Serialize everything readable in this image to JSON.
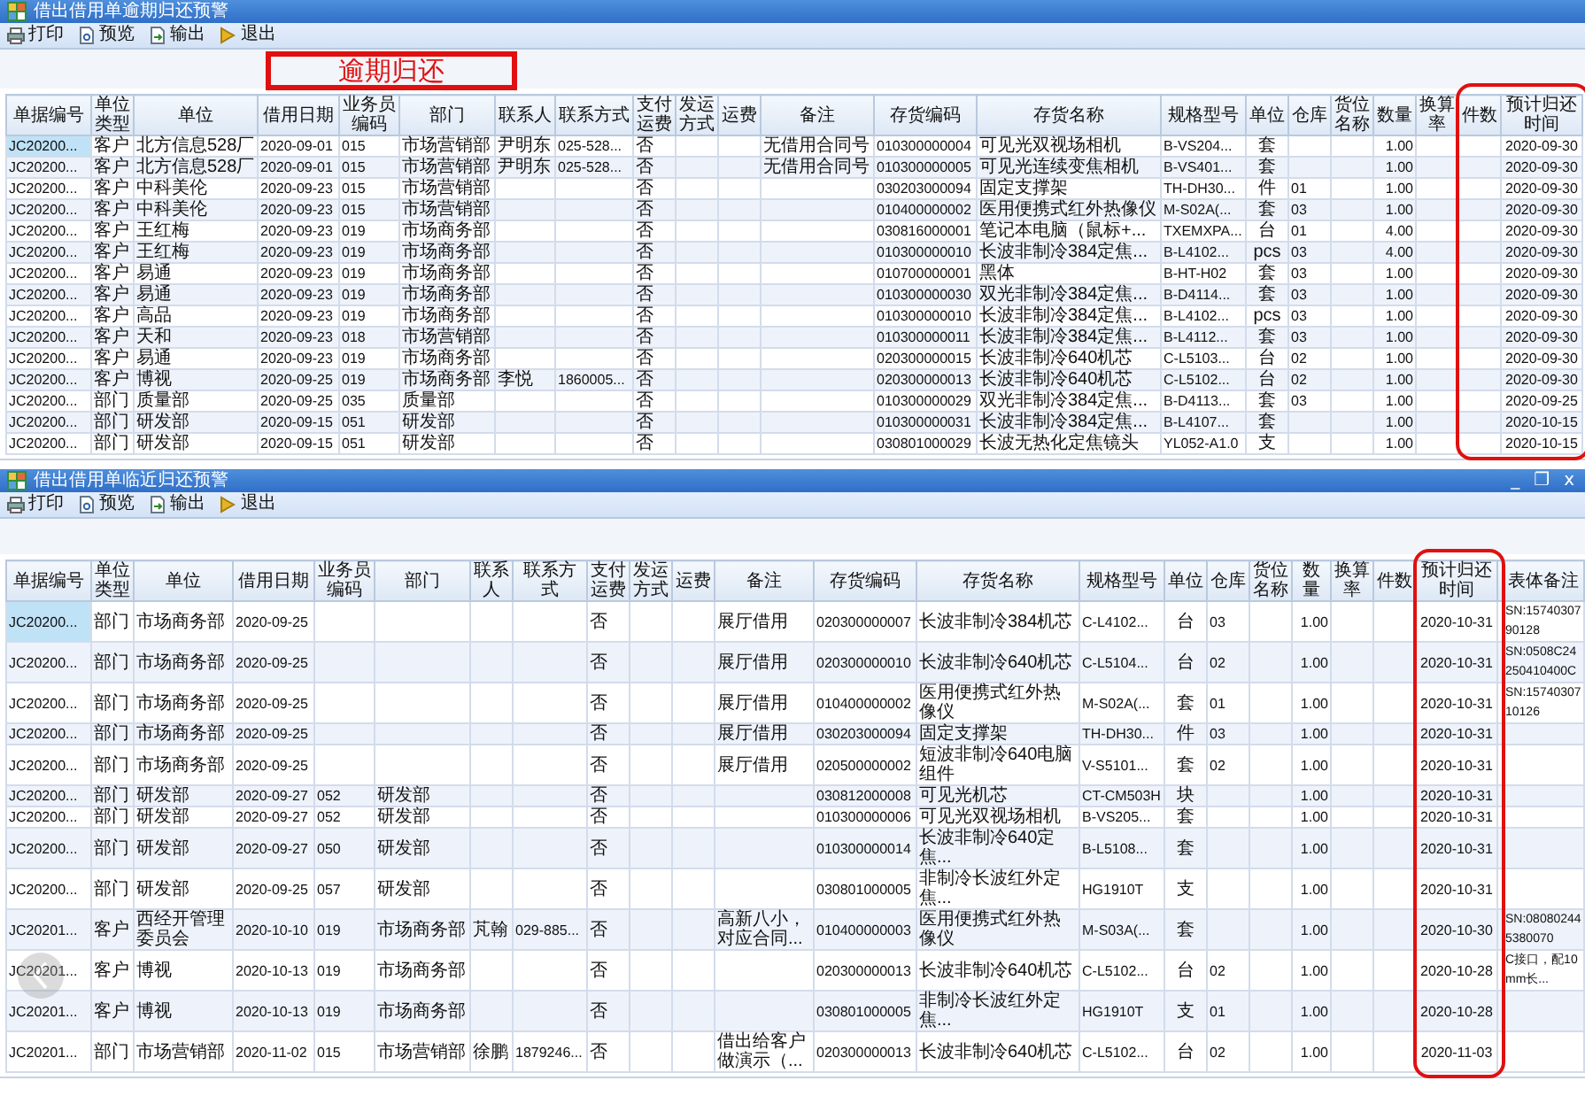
{
  "windows": [
    {
      "title": "借出借用单逾期归还预警",
      "toolbar": [
        {
          "label": "打印",
          "kind": "print"
        },
        {
          "label": "预览",
          "kind": "preview"
        },
        {
          "label": "输出",
          "kind": "export"
        },
        {
          "label": "退出",
          "kind": "exit"
        }
      ],
      "annotation": "逾期归还",
      "columns": [
        {
          "label": "单据编号",
          "highlighted": false
        },
        {
          "label": "单位类型",
          "highlighted": false
        },
        {
          "label": "单位",
          "highlighted": false
        },
        {
          "label": "借用日期",
          "highlighted": false
        },
        {
          "label": "业务员编码",
          "highlighted": false
        },
        {
          "label": "部门",
          "highlighted": false
        },
        {
          "label": "联系人",
          "highlighted": false
        },
        {
          "label": "联系方式",
          "highlighted": false
        },
        {
          "label": "支付运费",
          "highlighted": false
        },
        {
          "label": "发运方式",
          "highlighted": false
        },
        {
          "label": "运费",
          "highlighted": false
        },
        {
          "label": "备注",
          "highlighted": false
        },
        {
          "label": "存货编码",
          "highlighted": false
        },
        {
          "label": "存货名称",
          "highlighted": false
        },
        {
          "label": "规格型号",
          "highlighted": false
        },
        {
          "label": "单位",
          "highlighted": false
        },
        {
          "label": "仓库",
          "highlighted": false
        },
        {
          "label": "货位名称",
          "highlighted": false
        },
        {
          "label": "数量",
          "highlighted": false
        },
        {
          "label": "换算率",
          "highlighted": false
        },
        {
          "label": "件数",
          "highlighted": true
        },
        {
          "label": "预计归还时间",
          "highlighted": true
        }
      ],
      "rows": [
        {
          "selected": true,
          "cells": [
            "JC20200...",
            "客户",
            "北方信息528厂",
            "2020-09-01",
            "015",
            "市场营销部",
            "尹明东",
            "025-528...",
            "否",
            "",
            "",
            "无借用合同号",
            "010300000004",
            "可见光双视场相机",
            "B-VS204...",
            "套",
            "",
            "",
            "1.00",
            "",
            "",
            "2020-09-30"
          ]
        },
        {
          "selected": false,
          "cells": [
            "JC20200...",
            "客户",
            "北方信息528厂",
            "2020-09-01",
            "015",
            "市场营销部",
            "尹明东",
            "025-528...",
            "否",
            "",
            "",
            "无借用合同号",
            "010300000005",
            "可见光连续变焦相机",
            "B-VS401...",
            "套",
            "",
            "",
            "1.00",
            "",
            "",
            "2020-09-30"
          ]
        },
        {
          "selected": false,
          "cells": [
            "JC20200...",
            "客户",
            "中科美伦",
            "2020-09-23",
            "015",
            "市场营销部",
            "",
            "",
            "否",
            "",
            "",
            "",
            "030203000094",
            "固定支撑架",
            "TH-DH30...",
            "件",
            "01",
            "",
            "1.00",
            "",
            "",
            "2020-09-30"
          ]
        },
        {
          "selected": false,
          "cells": [
            "JC20200...",
            "客户",
            "中科美伦",
            "2020-09-23",
            "015",
            "市场营销部",
            "",
            "",
            "否",
            "",
            "",
            "",
            "010400000002",
            "医用便携式红外热像仪",
            "M-S02A(...",
            "套",
            "03",
            "",
            "1.00",
            "",
            "",
            "2020-09-30"
          ]
        },
        {
          "selected": false,
          "cells": [
            "JC20200...",
            "客户",
            "王红梅",
            "2020-09-23",
            "019",
            "市场商务部",
            "",
            "",
            "否",
            "",
            "",
            "",
            "030816000001",
            "笔记本电脑（鼠标+...",
            "TXEMXPA...",
            "台",
            "01",
            "",
            "4.00",
            "",
            "",
            "2020-09-30"
          ]
        },
        {
          "selected": false,
          "cells": [
            "JC20200...",
            "客户",
            "王红梅",
            "2020-09-23",
            "019",
            "市场商务部",
            "",
            "",
            "否",
            "",
            "",
            "",
            "010300000010",
            "长波非制冷384定焦...",
            "B-L4102...",
            "pcs",
            "03",
            "",
            "4.00",
            "",
            "",
            "2020-09-30"
          ]
        },
        {
          "selected": false,
          "cells": [
            "JC20200...",
            "客户",
            "易通",
            "2020-09-23",
            "019",
            "市场商务部",
            "",
            "",
            "否",
            "",
            "",
            "",
            "010700000001",
            "黑体",
            "B-HT-H02",
            "套",
            "03",
            "",
            "1.00",
            "",
            "",
            "2020-09-30"
          ]
        },
        {
          "selected": false,
          "cells": [
            "JC20200...",
            "客户",
            "易通",
            "2020-09-23",
            "019",
            "市场商务部",
            "",
            "",
            "否",
            "",
            "",
            "",
            "010300000030",
            "双光非制冷384定焦...",
            "B-D4114...",
            "套",
            "03",
            "",
            "1.00",
            "",
            "",
            "2020-09-30"
          ]
        },
        {
          "selected": false,
          "cells": [
            "JC20200...",
            "客户",
            "高品",
            "2020-09-23",
            "019",
            "市场商务部",
            "",
            "",
            "否",
            "",
            "",
            "",
            "010300000010",
            "长波非制冷384定焦...",
            "B-L4102...",
            "pcs",
            "03",
            "",
            "1.00",
            "",
            "",
            "2020-09-30"
          ]
        },
        {
          "selected": false,
          "cells": [
            "JC20200...",
            "客户",
            "天和",
            "2020-09-23",
            "018",
            "市场营销部",
            "",
            "",
            "否",
            "",
            "",
            "",
            "010300000011",
            "长波非制冷384定焦...",
            "B-L4112...",
            "套",
            "03",
            "",
            "1.00",
            "",
            "",
            "2020-09-30"
          ]
        },
        {
          "selected": false,
          "cells": [
            "JC20200...",
            "客户",
            "易通",
            "2020-09-23",
            "019",
            "市场商务部",
            "",
            "",
            "否",
            "",
            "",
            "",
            "020300000015",
            "长波非制冷640机芯",
            "C-L5103...",
            "台",
            "02",
            "",
            "1.00",
            "",
            "",
            "2020-09-30"
          ]
        },
        {
          "selected": false,
          "cells": [
            "JC20200...",
            "客户",
            "博视",
            "2020-09-25",
            "019",
            "市场商务部",
            "李悦",
            "1860005...",
            "否",
            "",
            "",
            "",
            "020300000013",
            "长波非制冷640机芯",
            "C-L5102...",
            "台",
            "02",
            "",
            "1.00",
            "",
            "",
            "2020-09-30"
          ]
        },
        {
          "selected": false,
          "cells": [
            "JC20200...",
            "部门",
            "质量部",
            "2020-09-25",
            "035",
            "质量部",
            "",
            "",
            "否",
            "",
            "",
            "",
            "010300000029",
            "双光非制冷384定焦...",
            "B-D4113...",
            "套",
            "03",
            "",
            "1.00",
            "",
            "",
            "2020-09-25"
          ]
        },
        {
          "selected": false,
          "cells": [
            "JC20200...",
            "部门",
            "研发部",
            "2020-09-15",
            "051",
            "研发部",
            "",
            "",
            "否",
            "",
            "",
            "",
            "010300000031",
            "长波非制冷384定焦...",
            "B-L4107...",
            "套",
            "",
            "",
            "1.00",
            "",
            "",
            "2020-10-15"
          ]
        },
        {
          "selected": false,
          "cells": [
            "JC20200...",
            "部门",
            "研发部",
            "2020-09-15",
            "051",
            "研发部",
            "",
            "",
            "否",
            "",
            "",
            "",
            "030801000029",
            "长波无热化定焦镜头",
            "YL052-A1.0",
            "支",
            "",
            "",
            "1.00",
            "",
            "",
            "2020-10-15"
          ]
        }
      ]
    },
    {
      "title": "借出借用单临近归还预警",
      "window_controls": [
        "_",
        "❐",
        "x"
      ],
      "toolbar": [
        {
          "label": "打印",
          "kind": "print"
        },
        {
          "label": "预览",
          "kind": "preview"
        },
        {
          "label": "输出",
          "kind": "export"
        },
        {
          "label": "退出",
          "kind": "exit"
        }
      ],
      "back_button": true,
      "columns": [
        {
          "label": "单据编号",
          "highlighted": false
        },
        {
          "label": "单位类型",
          "highlighted": false
        },
        {
          "label": "单位",
          "highlighted": false
        },
        {
          "label": "借用日期",
          "highlighted": false
        },
        {
          "label": "业务员编码",
          "highlighted": false
        },
        {
          "label": "部门",
          "highlighted": false
        },
        {
          "label": "联系人",
          "highlighted": false
        },
        {
          "label": "联系方式",
          "highlighted": false
        },
        {
          "label": "支付运费",
          "highlighted": false
        },
        {
          "label": "发运方式",
          "highlighted": false
        },
        {
          "label": "运费",
          "highlighted": false
        },
        {
          "label": "备注",
          "highlighted": false
        },
        {
          "label": "存货编码",
          "highlighted": false
        },
        {
          "label": "存货名称",
          "highlighted": false
        },
        {
          "label": "规格型号",
          "highlighted": false
        },
        {
          "label": "单位",
          "highlighted": false
        },
        {
          "label": "仓库",
          "highlighted": false
        },
        {
          "label": "货位名称",
          "highlighted": false
        },
        {
          "label": "数量",
          "highlighted": false
        },
        {
          "label": "换算率",
          "highlighted": false
        },
        {
          "label": "件数",
          "highlighted": false
        },
        {
          "label": "预计归还时间",
          "highlighted": true
        },
        {
          "label": "表体备注",
          "highlighted": false
        }
      ],
      "rows": [
        {
          "selected": true,
          "cells": [
            "JC20200...",
            "部门",
            "市场商务部",
            "2020-09-25",
            "",
            "",
            "",
            "",
            "否",
            "",
            "",
            "展厅借用",
            "020300000007",
            "长波非制冷384机芯",
            "C-L4102...",
            "台",
            "03",
            "",
            "1.00",
            "",
            "",
            "2020-10-31",
            "SN:1574030790128"
          ]
        },
        {
          "selected": false,
          "cells": [
            "JC20200...",
            "部门",
            "市场商务部",
            "2020-09-25",
            "",
            "",
            "",
            "",
            "否",
            "",
            "",
            "展厅借用",
            "020300000010",
            "长波非制冷640机芯",
            "C-L5104...",
            "台",
            "02",
            "",
            "1.00",
            "",
            "",
            "2020-10-31",
            "SN:0508C24250410400C"
          ]
        },
        {
          "selected": false,
          "cells": [
            "JC20200...",
            "部门",
            "市场商务部",
            "2020-09-25",
            "",
            "",
            "",
            "",
            "否",
            "",
            "",
            "展厅借用",
            "010400000002",
            "医用便携式红外热像仪",
            "M-S02A(...",
            "套",
            "01",
            "",
            "1.00",
            "",
            "",
            "2020-10-31",
            "SN:1574030710126"
          ]
        },
        {
          "selected": false,
          "cells": [
            "JC20200...",
            "部门",
            "市场商务部",
            "2020-09-25",
            "",
            "",
            "",
            "",
            "否",
            "",
            "",
            "展厅借用",
            "030203000094",
            "固定支撑架",
            "TH-DH30...",
            "件",
            "03",
            "",
            "1.00",
            "",
            "",
            "2020-10-31",
            ""
          ]
        },
        {
          "selected": false,
          "cells": [
            "JC20200...",
            "部门",
            "市场商务部",
            "2020-09-25",
            "",
            "",
            "",
            "",
            "否",
            "",
            "",
            "展厅借用",
            "020500000002",
            "短波非制冷640电脑组件",
            "V-S5101...",
            "套",
            "02",
            "",
            "1.00",
            "",
            "",
            "2020-10-31",
            ""
          ]
        },
        {
          "selected": false,
          "cells": [
            "JC20200...",
            "部门",
            "研发部",
            "2020-09-27",
            "052",
            "研发部",
            "",
            "",
            "否",
            "",
            "",
            "",
            "030812000008",
            "可见光机芯",
            "CT-CM503H",
            "块",
            "",
            "",
            "1.00",
            "",
            "",
            "2020-10-31",
            ""
          ]
        },
        {
          "selected": false,
          "cells": [
            "JC20200...",
            "部门",
            "研发部",
            "2020-09-27",
            "052",
            "研发部",
            "",
            "",
            "否",
            "",
            "",
            "",
            "010300000006",
            "可见光双视场相机",
            "B-VS205...",
            "套",
            "",
            "",
            "1.00",
            "",
            "",
            "2020-10-31",
            ""
          ]
        },
        {
          "selected": false,
          "cells": [
            "JC20200...",
            "部门",
            "研发部",
            "2020-09-27",
            "050",
            "研发部",
            "",
            "",
            "否",
            "",
            "",
            "",
            "010300000014",
            "长波非制冷640定焦...",
            "B-L5108...",
            "套",
            "",
            "",
            "1.00",
            "",
            "",
            "2020-10-31",
            ""
          ]
        },
        {
          "selected": false,
          "cells": [
            "JC20200...",
            "部门",
            "研发部",
            "2020-09-25",
            "057",
            "研发部",
            "",
            "",
            "否",
            "",
            "",
            "",
            "030801000005",
            "非制冷长波红外定焦...",
            "HG1910T",
            "支",
            "",
            "",
            "1.00",
            "",
            "",
            "2020-10-31",
            ""
          ]
        },
        {
          "selected": false,
          "cells": [
            "JC20201...",
            "客户",
            "西经开管理委员会",
            "2020-10-10",
            "019",
            "市场商务部",
            "芃翰",
            "029-885...",
            "否",
            "",
            "",
            "高新八小，对应合同...",
            "010400000003",
            "医用便携式红外热像仪",
            "M-S03A(...",
            "套",
            "",
            "",
            "1.00",
            "",
            "",
            "2020-10-30",
            "SN:080802445380070"
          ]
        },
        {
          "selected": false,
          "cells": [
            "JC20201...",
            "客户",
            "博视",
            "2020-10-13",
            "019",
            "市场商务部",
            "",
            "",
            "否",
            "",
            "",
            "",
            "020300000013",
            "长波非制冷640机芯",
            "C-L5102...",
            "台",
            "02",
            "",
            "1.00",
            "",
            "",
            "2020-10-28",
            "C接口，配10mm长..."
          ]
        },
        {
          "selected": false,
          "cells": [
            "JC20201...",
            "客户",
            "博视",
            "2020-10-13",
            "019",
            "市场商务部",
            "",
            "",
            "否",
            "",
            "",
            "",
            "030801000005",
            "非制冷长波红外定焦...",
            "HG1910T",
            "支",
            "01",
            "",
            "1.00",
            "",
            "",
            "2020-10-28",
            ""
          ]
        },
        {
          "selected": false,
          "cells": [
            "JC20201...",
            "部门",
            "市场营销部",
            "2020-11-02",
            "015",
            "市场营销部",
            "徐鹏",
            "1879246...",
            "否",
            "",
            "",
            "借出给客户做演示（...",
            "020300000013",
            "长波非制冷640机芯",
            "C-L5102...",
            "台",
            "02",
            "",
            "1.00",
            "",
            "",
            "2020-11-03",
            ""
          ]
        }
      ]
    }
  ]
}
